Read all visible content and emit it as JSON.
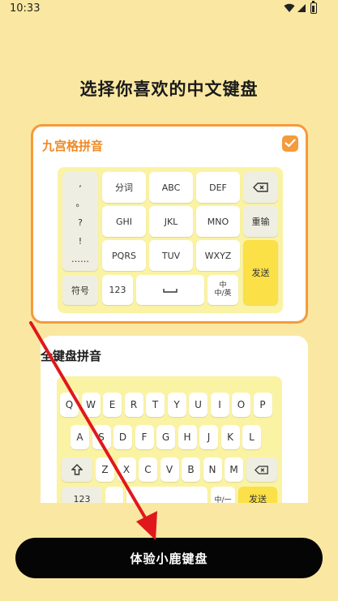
{
  "status_bar": {
    "time": "10:33"
  },
  "page_title": "选择你喜欢的中文键盘",
  "nine_grid": {
    "label": "九宫格拼音",
    "selected": true,
    "punct": [
      ",",
      "。",
      "?",
      "!",
      "……"
    ],
    "letter_keys": [
      "分词",
      "ABC",
      "DEF",
      "GHI",
      "JKL",
      "MNO",
      "PQRS",
      "TUV",
      "WXYZ"
    ],
    "reenter": "重输",
    "send": "发送",
    "symbols": "符号",
    "numbers": "123",
    "lang_top": "中",
    "lang_bottom": "中/英"
  },
  "full_keyboard": {
    "label": "全键盘拼音",
    "row1": [
      "Q",
      "W",
      "E",
      "R",
      "T",
      "Y",
      "U",
      "I",
      "O",
      "P"
    ],
    "row2": [
      "A",
      "S",
      "D",
      "F",
      "G",
      "H",
      "J",
      "K",
      "L"
    ],
    "row3": [
      "Z",
      "X",
      "C",
      "V",
      "B",
      "N",
      "M"
    ],
    "numbers": "123",
    "lang": "中/一",
    "send": "发送"
  },
  "cta_label": "体验小鹿键盘",
  "colors": {
    "accent": "#f49b3c",
    "background": "#fae8a2",
    "key_yellow": "#fbe047",
    "arrow": "#e0181b"
  }
}
